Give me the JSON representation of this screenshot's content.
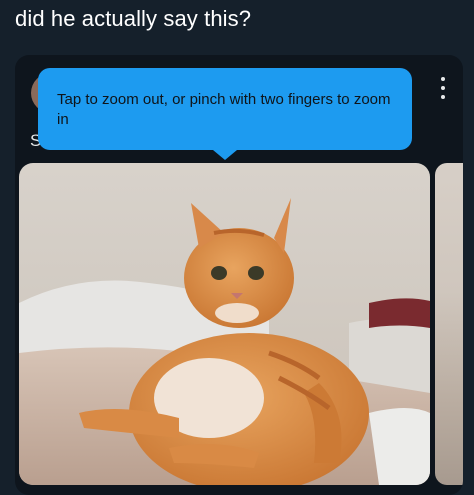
{
  "post": {
    "caption": "did he actually say this?"
  },
  "card": {
    "sender_initial": "S",
    "more_icon": "more-vertical-icon"
  },
  "tooltip": {
    "text": "Tap to zoom out, or pinch with two fingers to zoom in",
    "color": "#1d9bf0"
  },
  "colors": {
    "background": "#15202b",
    "card": "#0e151d",
    "text": "#ffffff"
  }
}
